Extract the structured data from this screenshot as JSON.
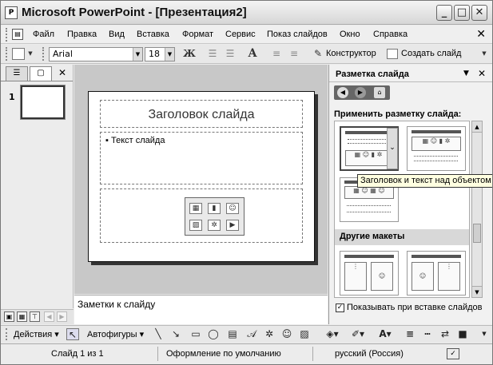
{
  "window": {
    "title": "Microsoft PowerPoint - [Презентация2]",
    "app_icon": "powerpoint-icon",
    "min_label": "_",
    "max_label": "□",
    "close_label": "✕"
  },
  "menu": {
    "items": [
      "Файл",
      "Правка",
      "Вид",
      "Вставка",
      "Формат",
      "Сервис",
      "Показ слайдов",
      "Окно",
      "Справка"
    ],
    "close": "✕"
  },
  "toolbar": {
    "font_name": "Arial",
    "font_size": "18",
    "bold": "Ж",
    "grow_font": "A",
    "designer": "Конструктор",
    "new_slide": "Создать слайд"
  },
  "left_panel": {
    "close": "✕",
    "slide_number": "1"
  },
  "slide": {
    "title_placeholder": "Заголовок слайда",
    "body_placeholder": "Текст слайда"
  },
  "notes": {
    "placeholder": "Заметки к слайду"
  },
  "task_pane": {
    "title": "Разметка слайда",
    "apply_label": "Применить разметку слайда:",
    "other_layouts": "Другие макеты",
    "tooltip": "Заголовок и текст над объектом",
    "show_on_insert": "Показывать при вставке слайдов",
    "show_on_insert_checked": true
  },
  "draw_toolbar": {
    "actions": "Действия",
    "autoshapes": "Автофигуры"
  },
  "status": {
    "slide": "Слайд 1 из 1",
    "design": "Оформление по умолчанию",
    "language": "русский (Россия)"
  }
}
